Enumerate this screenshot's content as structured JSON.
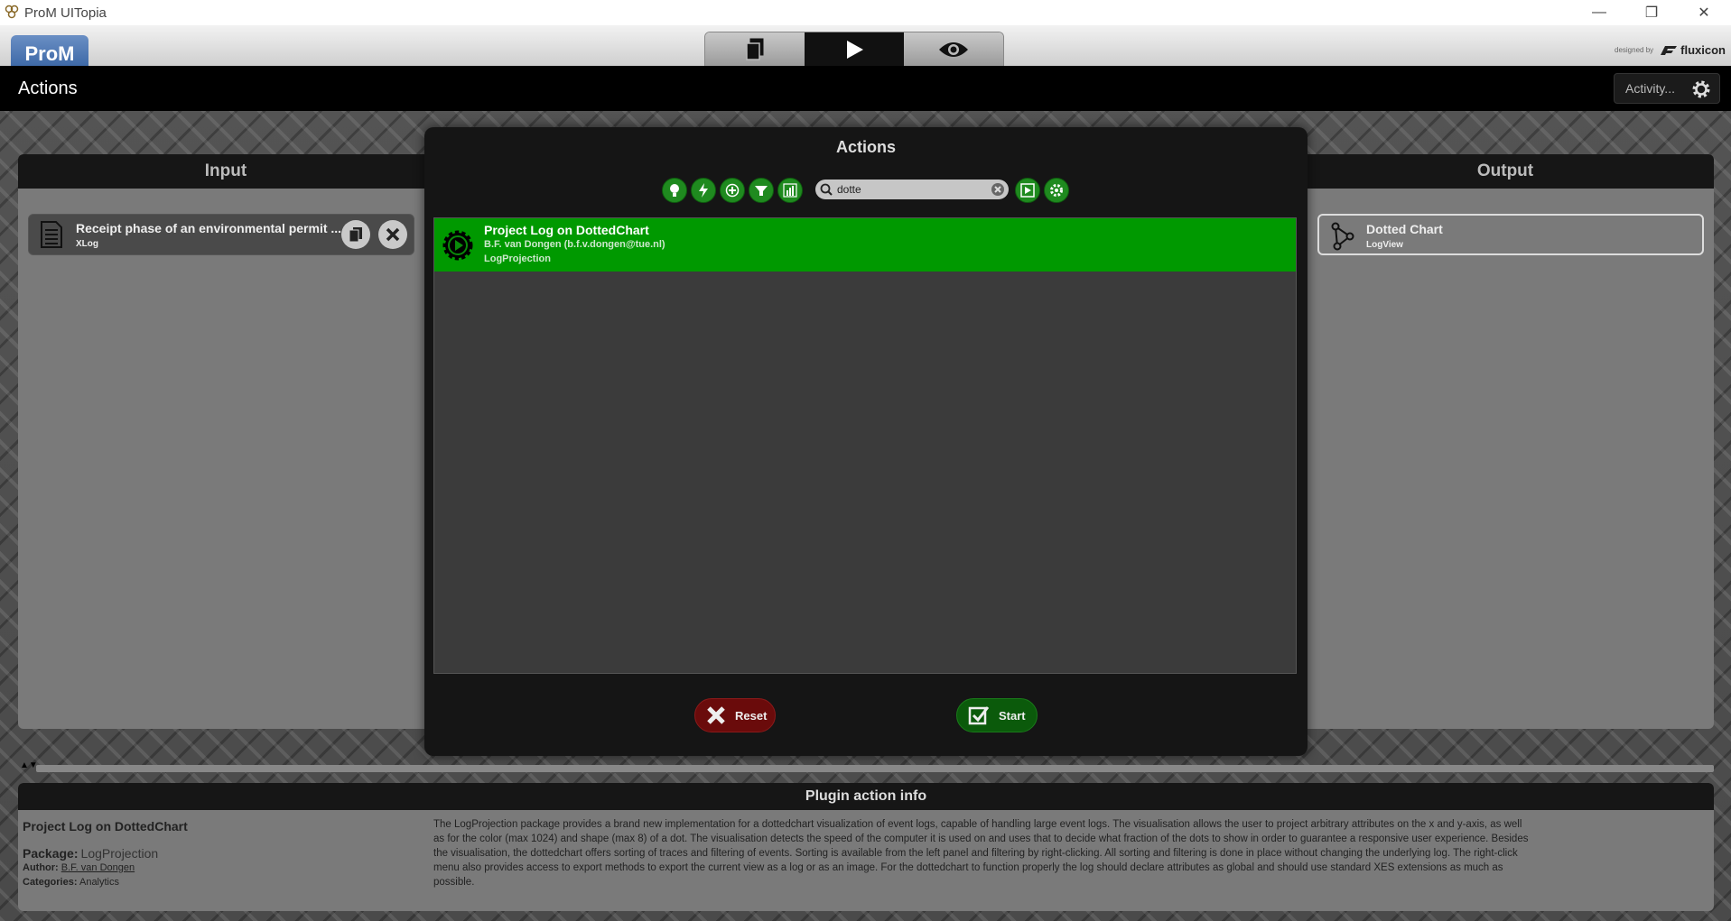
{
  "window": {
    "title": "ProM UITopia",
    "minimize_glyph": "—",
    "restore_glyph": "❐",
    "close_glyph": "✕"
  },
  "toolbar": {
    "logo_text": "ProM",
    "tabs": [
      {
        "name": "workspace",
        "icon": "documents-icon"
      },
      {
        "name": "actions",
        "icon": "play-icon",
        "active": true
      },
      {
        "name": "views",
        "icon": "eye-icon"
      }
    ],
    "designed_by": "designed by",
    "brand": "fluxicon"
  },
  "header": {
    "title": "Actions",
    "activity_label": "Activity..."
  },
  "input_panel": {
    "title": "Input",
    "item": {
      "name": "Receipt phase of an environmental permit ...",
      "type": "XLog"
    }
  },
  "output_panel": {
    "title": "Output",
    "item": {
      "name": "Dotted Chart",
      "type": "LogView"
    }
  },
  "dialog": {
    "title": "Actions",
    "filters": [
      "lightbulb-icon",
      "bolt-icon",
      "plus-icon",
      "funnel-icon",
      "chart-icon"
    ],
    "search": {
      "value": "dotte",
      "placeholder": ""
    },
    "results": [
      {
        "name": "Project Log on DottedChart",
        "author": "B.F. van Dongen (b.f.v.dongen@tue.nl)",
        "package": "LogProjection"
      }
    ],
    "reset_label": "Reset",
    "start_label": "Start"
  },
  "info": {
    "title": "Plugin action info",
    "plugin_name": "Project Log on DottedChart",
    "package_label": "Package:",
    "package_value": "LogProjection",
    "author_label": "Author:",
    "author_value": "B.F. van Dongen",
    "categories_label": "Categories:",
    "categories_value": "Analytics",
    "description": "The LogProjection package provides a brand new implementation for a dottedchart visualization of event logs, capable of handling large event logs. The visualisation allows the user to project arbitrary attributes on the x and y-axis, as well as for the color (max 1024) and shape (max 8) of a dot. The visualisation detects the speed of the computer it is used on and uses that to decide what fraction of the dots to show in order to guarantee a responsive user experience. Besides the visualisation, the dottedchart offers sorting of traces and filtering of events. Sorting is available from the left panel and filtering by right-clicking. All sorting and filtering is done in place without changing the underlying log. The right-click menu also provides access to export methods to export the current view as a log or as an image. For the dottedchart to function properly the log should declare attributes as global and should use standard XES extensions as much as possible."
  },
  "colors": {
    "accent_green": "#009900",
    "reset_red": "#6a0b0b",
    "start_green": "#0b5a0b"
  }
}
